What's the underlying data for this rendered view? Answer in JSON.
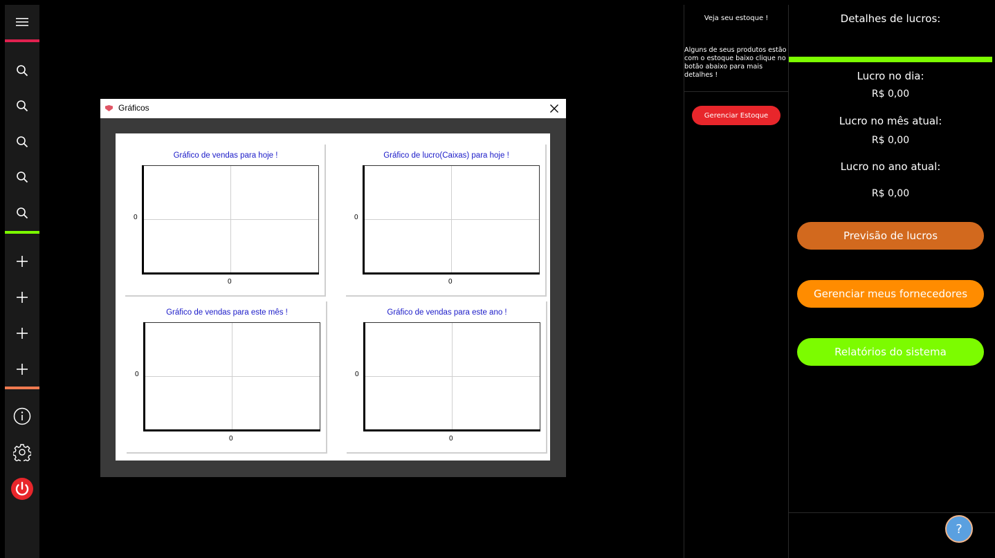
{
  "sidebar": {
    "items": [
      {
        "icon": "menu-icon"
      },
      {
        "icon": "search-icon"
      },
      {
        "icon": "search-icon"
      },
      {
        "icon": "search-icon"
      },
      {
        "icon": "search-icon"
      },
      {
        "icon": "search-icon"
      },
      {
        "icon": "plus-icon"
      },
      {
        "icon": "plus-icon"
      },
      {
        "icon": "plus-icon"
      },
      {
        "icon": "plus-icon"
      },
      {
        "icon": "info-icon"
      },
      {
        "icon": "gear-icon"
      },
      {
        "icon": "power-icon"
      }
    ],
    "accent_colors": [
      "#e0214f",
      "#7cfc00",
      "#f07a50"
    ]
  },
  "stock": {
    "title": "Veja seu estoque !",
    "message": "Alguns de seus produtos estão com o estoque baixo clique no botão abaixo para mais detalhes !",
    "button": "Gerenciar Estoque",
    "button_color": "#e8262b"
  },
  "profit": {
    "title": "Detalhes de lucros:",
    "day_label": "Lucro no dia:",
    "day_value": "R$ 0,00",
    "month_label": "Lucro no mês atual:",
    "month_value": "R$ 0,00",
    "year_label": "Lucro no ano atual:",
    "year_value": "R$ 0,00",
    "buttons": [
      {
        "label": "Previsão de lucros",
        "color": "#d2691e"
      },
      {
        "label": "Gerenciar meus fornecedores",
        "color": "#ff8c00"
      },
      {
        "label": "Relatórios do sistema",
        "color": "#7cfc00"
      }
    ],
    "bar_color": "#7cfc00",
    "help_icon": "help-icon"
  },
  "dialog": {
    "title": "Gráficos",
    "close_icon": "close-icon"
  },
  "chart_data": [
    {
      "type": "bar",
      "title": "Gráfico de vendas para hoje !",
      "categories": [
        "0"
      ],
      "values": [
        0
      ],
      "y_ticks": [
        "0"
      ],
      "grid": true
    },
    {
      "type": "bar",
      "title": "Gráfico de lucro(Caixas) para hoje !",
      "categories": [
        "0"
      ],
      "values": [
        0
      ],
      "y_ticks": [
        "0"
      ],
      "grid": true
    },
    {
      "type": "bar",
      "title": "Gráfico de vendas para este mês !",
      "categories": [
        "0"
      ],
      "values": [
        0
      ],
      "y_ticks": [
        "0"
      ],
      "grid": true
    },
    {
      "type": "bar",
      "title": "Gráfico de vendas para este ano !",
      "categories": [
        "0"
      ],
      "values": [
        0
      ],
      "y_ticks": [
        "0"
      ],
      "grid": true
    }
  ]
}
